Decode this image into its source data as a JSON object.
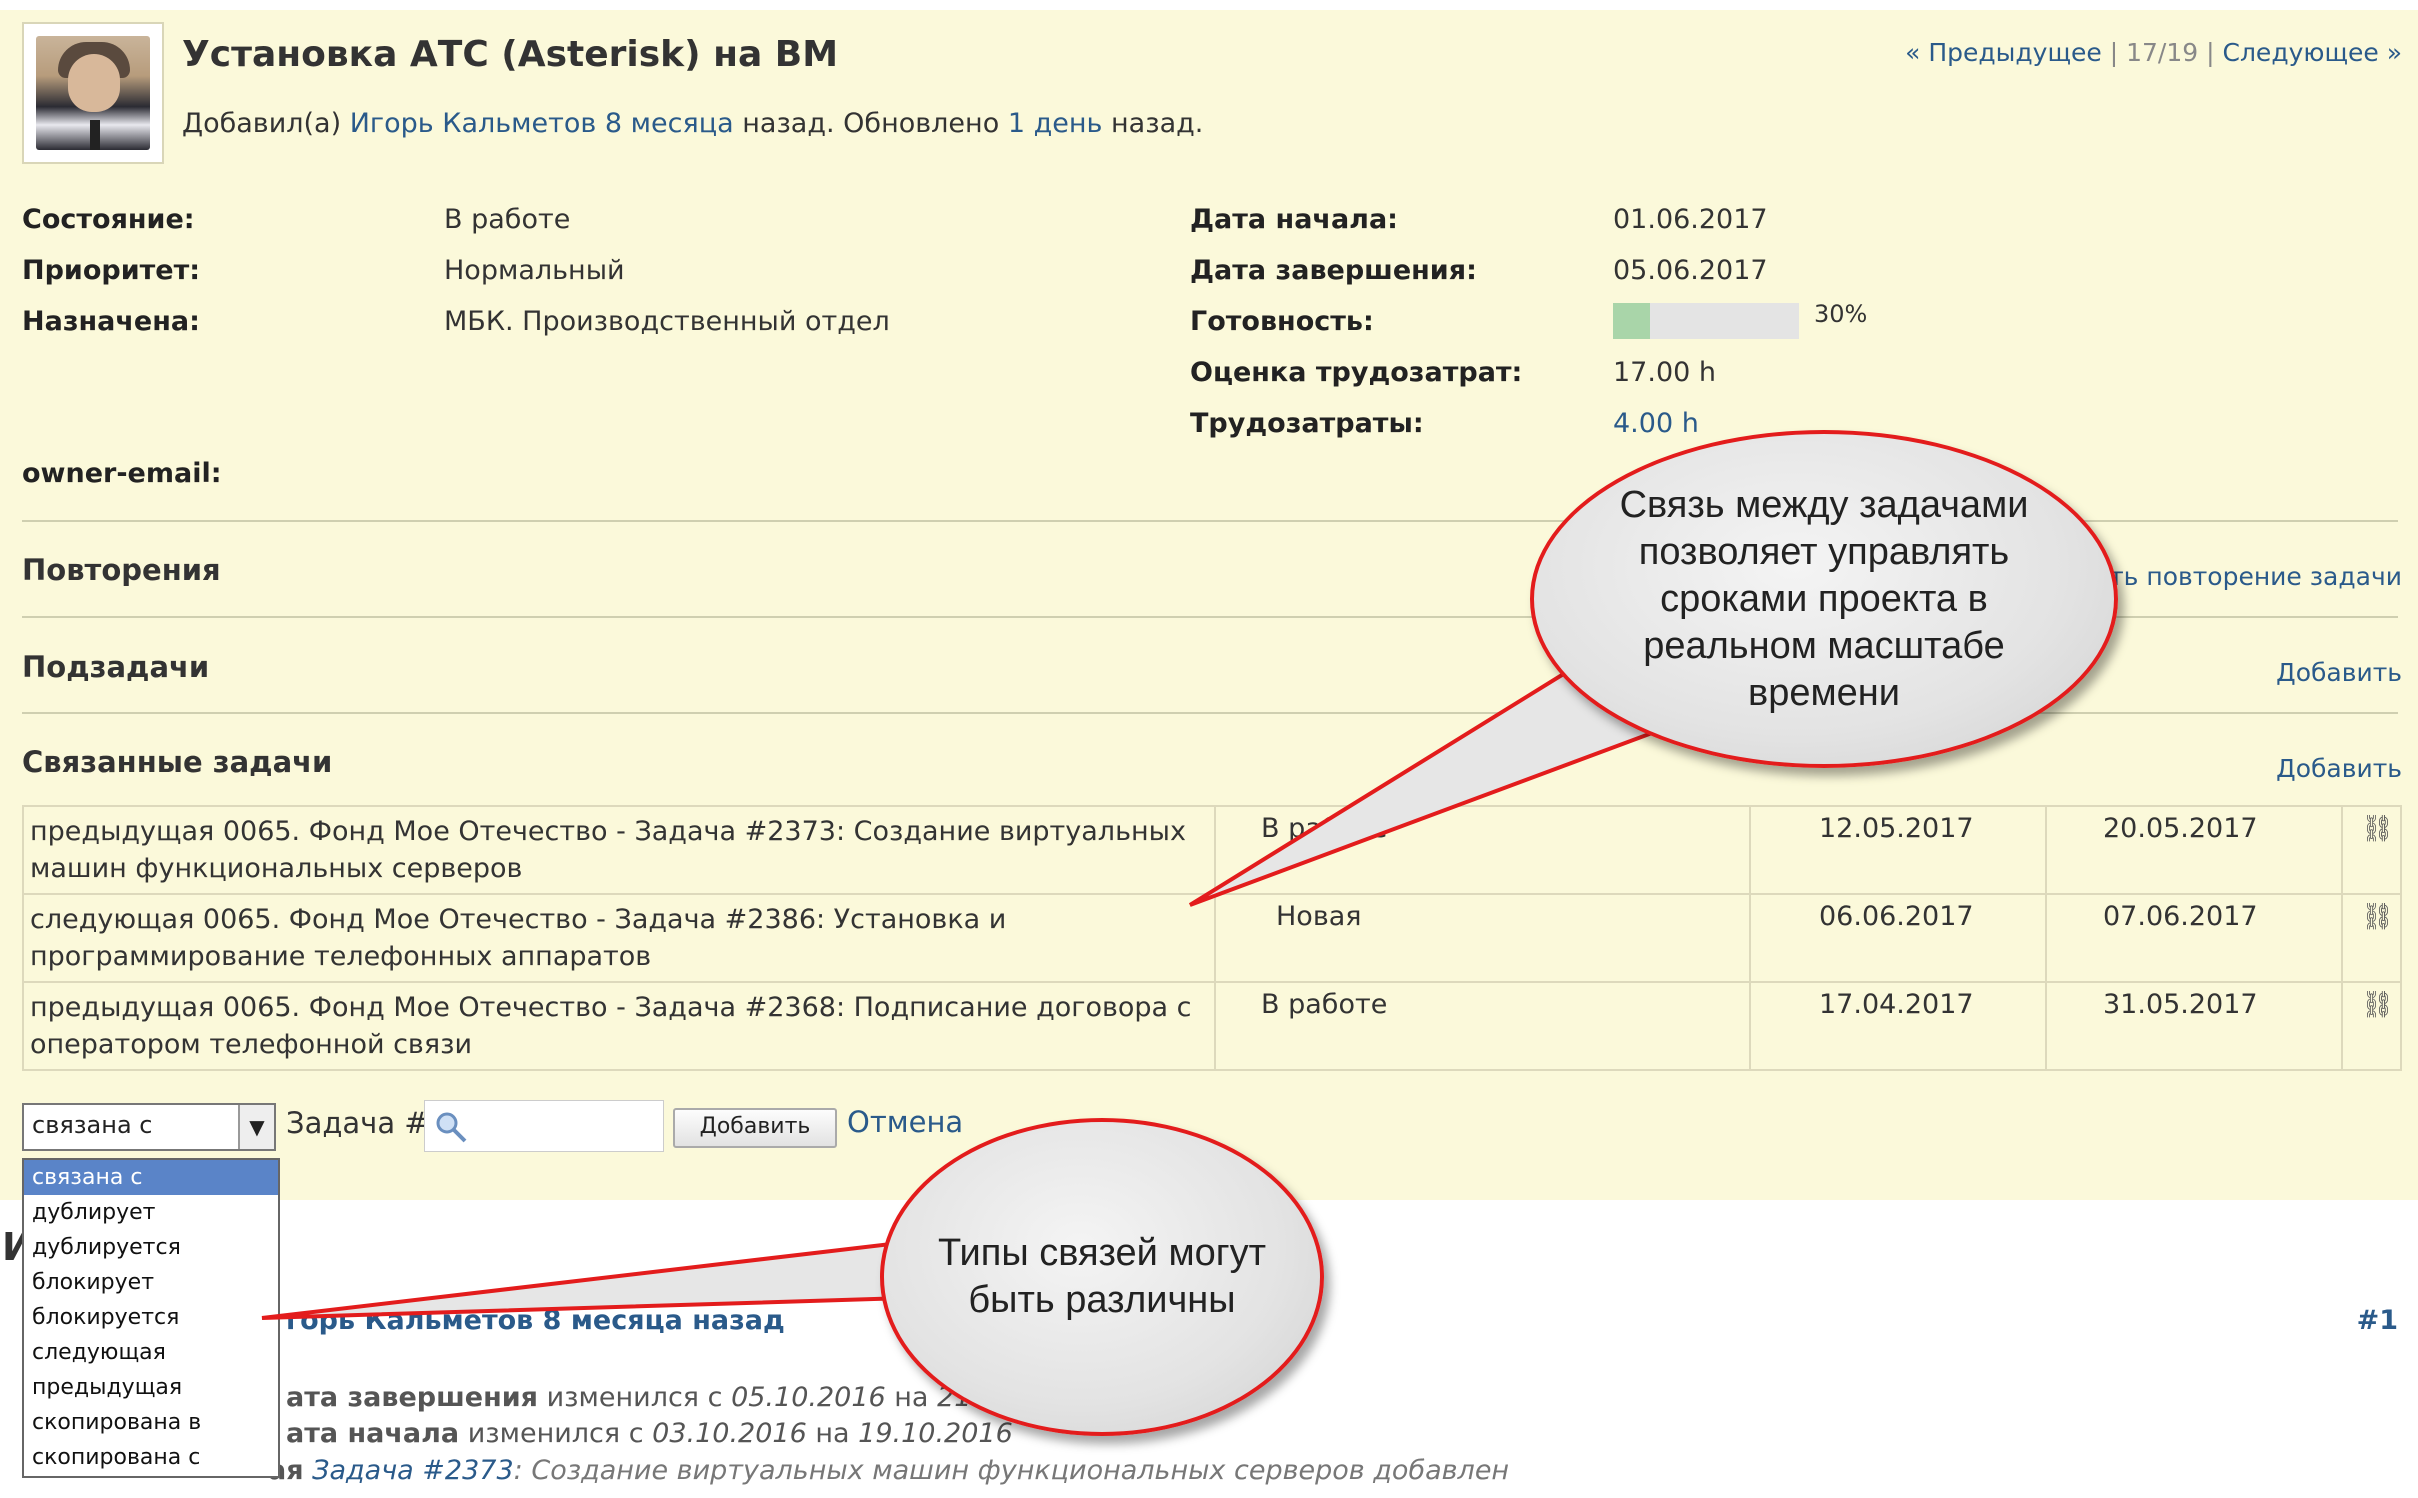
{
  "issue": {
    "title": "Установка АТС (Asterisk) на ВМ",
    "author_prefix": "Добавил(а)",
    "author_name": "Игорь Кальметов",
    "added_ago": "8 месяца",
    "added_suffix": "назад. Обновлено",
    "updated_ago": "1 день",
    "updated_suffix": "назад.",
    "nav_prev": "« Предыдущее",
    "nav_position": "17/19",
    "nav_next": "Следующее »"
  },
  "attributes_left": [
    {
      "label": "Состояние:",
      "value": "В работе"
    },
    {
      "label": "Приоритет:",
      "value": "Нормальный"
    },
    {
      "label": "Назначена:",
      "value": "МБК. Производственный отдел"
    }
  ],
  "attributes_right": [
    {
      "label": "Дата начала:",
      "value": "01.06.2017"
    },
    {
      "label": "Дата завершения:",
      "value": "05.06.2017"
    },
    {
      "label": "Готовность:",
      "value": "30%",
      "progress": 0.2
    },
    {
      "label": "Оценка трудозатрат:",
      "value": "17.00 h"
    },
    {
      "label": "Трудозатраты:",
      "value": "4.00 h"
    }
  ],
  "owner_email_label": "owner-email:",
  "sections": {
    "repeats": "Повторения",
    "repeats_link": "ть повторение задачи",
    "subtasks": "Подзадачи",
    "subtasks_add": "Добавить",
    "related": "Связанные задачи",
    "related_add": "Добавить"
  },
  "related_rows": [
    {
      "subject": "предыдущая 0065. Фонд Мое Отечество - Задача #2373: Создание виртуальных машин функциональных серверов",
      "status": "В работе",
      "start": "12.05.2017",
      "end": "20.05.2017"
    },
    {
      "subject": "следующая 0065. Фонд Мое Отечество - Задача #2386: Установка и программирование телефонных аппаратов",
      "status": "Новая",
      "start": "06.06.2017",
      "end": "07.06.2017"
    },
    {
      "subject": "предыдущая 0065. Фонд Мое Отечество - Задача #2368: Подписание договора с оператором телефонной связи",
      "status": "В работе",
      "start": "17.04.2017",
      "end": "31.05.2017"
    }
  ],
  "relation_form": {
    "selected": "связана с",
    "task_label": "Задача #",
    "add_button": "Добавить",
    "cancel": "Отмена",
    "options": [
      "связана с",
      "дублирует",
      "дублируется",
      "блокирует",
      "блокируется",
      "следующая",
      "предыдущая",
      "скопирована в",
      "скопирована с"
    ]
  },
  "history": {
    "heading_letter": "И",
    "journal_author": "горь Кальметов 8 месяца назад",
    "journal_number": "#1",
    "line1_label": "ата завершения",
    "line1_text": "изменился с",
    "line1_from": "05.10.2016",
    "line1_to_text": "на",
    "line1_to": "21",
    "line2_label": "ата начала",
    "line2_text": "изменился с",
    "line2_from": "03.10.2016",
    "line2_to_text": "на",
    "line2_to": "19.10.2016",
    "line3_label": "ая",
    "line3_link": "Задача #2373",
    "line3_text": ": Создание виртуальных машин функциональных серверов добавлен"
  },
  "callouts": {
    "top": "Связь между задачами позволяет управлять сроками проекта в реальном масштабе времени",
    "bottom": "Типы связей могут быть различны"
  },
  "colors": {
    "accent_red": "#e31c1c",
    "issue_bg": "#fbf9da",
    "link": "#2a5a8a",
    "progress_done": "#a9d5a9"
  }
}
